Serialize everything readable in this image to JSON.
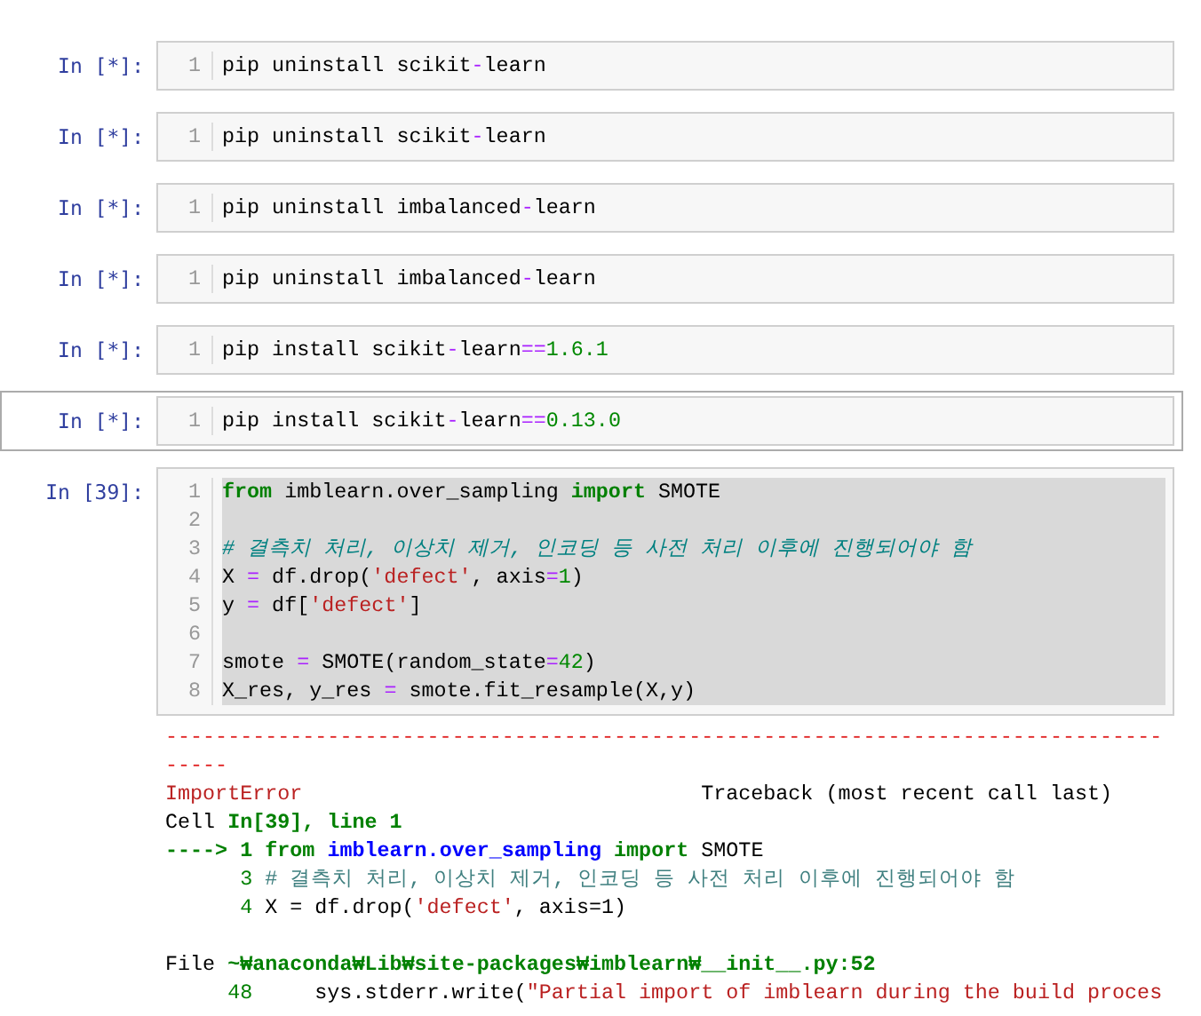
{
  "cells": [
    {
      "prompt": "In [*]:",
      "selected": false,
      "lines": [
        {
          "number": "1",
          "selected": false,
          "tokens": [
            {
              "kind": "plain",
              "text": "pip uninstall scikit"
            },
            {
              "kind": "op",
              "text": "-"
            },
            {
              "kind": "plain",
              "text": "learn"
            }
          ]
        }
      ]
    },
    {
      "prompt": "In [*]:",
      "selected": false,
      "lines": [
        {
          "number": "1",
          "selected": false,
          "tokens": [
            {
              "kind": "plain",
              "text": "pip uninstall scikit"
            },
            {
              "kind": "op",
              "text": "-"
            },
            {
              "kind": "plain",
              "text": "learn"
            }
          ]
        }
      ]
    },
    {
      "prompt": "In [*]:",
      "selected": false,
      "lines": [
        {
          "number": "1",
          "selected": false,
          "tokens": [
            {
              "kind": "plain",
              "text": "pip uninstall imbalanced"
            },
            {
              "kind": "op",
              "text": "-"
            },
            {
              "kind": "plain",
              "text": "learn"
            }
          ]
        }
      ]
    },
    {
      "prompt": "In [*]:",
      "selected": false,
      "lines": [
        {
          "number": "1",
          "selected": false,
          "tokens": [
            {
              "kind": "plain",
              "text": "pip uninstall imbalanced"
            },
            {
              "kind": "op",
              "text": "-"
            },
            {
              "kind": "plain",
              "text": "learn"
            }
          ]
        }
      ]
    },
    {
      "prompt": "In [*]:",
      "selected": false,
      "lines": [
        {
          "number": "1",
          "selected": false,
          "tokens": [
            {
              "kind": "plain",
              "text": "pip install scikit"
            },
            {
              "kind": "op",
              "text": "-"
            },
            {
              "kind": "plain",
              "text": "learn"
            },
            {
              "kind": "op",
              "text": "=="
            },
            {
              "kind": "num",
              "text": "1.6.1"
            }
          ]
        }
      ]
    },
    {
      "prompt": "In [*]:",
      "selected": true,
      "lines": [
        {
          "number": "1",
          "selected": false,
          "tokens": [
            {
              "kind": "plain",
              "text": "pip install scikit"
            },
            {
              "kind": "op",
              "text": "-"
            },
            {
              "kind": "plain",
              "text": "learn"
            },
            {
              "kind": "op",
              "text": "=="
            },
            {
              "kind": "num",
              "text": "0.13.0"
            }
          ]
        }
      ]
    },
    {
      "prompt": "In [39]:",
      "selected": false,
      "lines": [
        {
          "number": "1",
          "selected": true,
          "tokens": [
            {
              "kind": "kw",
              "text": "from"
            },
            {
              "kind": "plain",
              "text": " imblearn.over_sampling "
            },
            {
              "kind": "kw",
              "text": "import"
            },
            {
              "kind": "plain",
              "text": " SMOTE"
            }
          ]
        },
        {
          "number": "2",
          "selected": true
        },
        {
          "number": "3",
          "selected": true,
          "tokens": [
            {
              "kind": "comment",
              "text": "# 결측치 처리, 이상치 제거, 인코딩 등 사전 처리 이후에 진행되어야 함"
            }
          ]
        },
        {
          "number": "4",
          "selected": true,
          "tokens": [
            {
              "kind": "plain",
              "text": "X "
            },
            {
              "kind": "op",
              "text": "="
            },
            {
              "kind": "plain",
              "text": " df.drop("
            },
            {
              "kind": "str",
              "text": "'defect'"
            },
            {
              "kind": "plain",
              "text": ", axis"
            },
            {
              "kind": "op",
              "text": "="
            },
            {
              "kind": "num",
              "text": "1"
            },
            {
              "kind": "plain",
              "text": ")"
            }
          ]
        },
        {
          "number": "5",
          "selected": true,
          "tokens": [
            {
              "kind": "plain",
              "text": "y "
            },
            {
              "kind": "op",
              "text": "="
            },
            {
              "kind": "plain",
              "text": " df["
            },
            {
              "kind": "str",
              "text": "'defect'"
            },
            {
              "kind": "plain",
              "text": "]"
            }
          ]
        },
        {
          "number": "6",
          "selected": true
        },
        {
          "number": "7",
          "selected": true,
          "tokens": [
            {
              "kind": "plain",
              "text": "smote "
            },
            {
              "kind": "op",
              "text": "="
            },
            {
              "kind": "plain",
              "text": " SMOTE(random_state"
            },
            {
              "kind": "op",
              "text": "="
            },
            {
              "kind": "num",
              "text": "42"
            },
            {
              "kind": "plain",
              "text": ")"
            }
          ]
        },
        {
          "number": "8",
          "selected": true,
          "tokens": [
            {
              "kind": "plain",
              "text": "X_res, y_res "
            },
            {
              "kind": "op",
              "text": "="
            },
            {
              "kind": "plain",
              "text": " smote.fit_resample(X,y)"
            }
          ]
        }
      ],
      "output": {
        "rule": "-------------------------------------------------------------------------------------",
        "error": "ImportError",
        "note": "Traceback (most recent call last)",
        "lines": [
          {
            "tokens": [
              {
                "kind": "plain",
                "text": "Cell "
              },
              {
                "kind": "loc",
                "text": "In[39], line 1"
              }
            ]
          },
          {
            "tokens": [
              {
                "kind": "arrow",
                "text": "----> 1"
              },
              {
                "kind": "kw",
                "text": " from"
              },
              {
                "kind": "mod",
                "text": " imblearn.over_sampling"
              },
              {
                "kind": "kw",
                "text": " import"
              },
              {
                "kind": "plain",
                "text": " SMOTE"
              }
            ]
          },
          {
            "tokens": [
              {
                "kind": "lineno",
                "text": "3"
              },
              {
                "kind": "tbcomment",
                "text": "# 결측치 처리, 이상치 제거, 인코딩 등 사전 처리 이후에 진행되어야 함"
              }
            ]
          },
          {
            "tokens": [
              {
                "kind": "lineno",
                "text": "4"
              },
              {
                "kind": "plain",
                "text": "X = df.drop("
              },
              {
                "kind": "str",
                "text": "'defect'"
              },
              {
                "kind": "plain",
                "text": ", axis=1)"
              }
            ]
          }
        ],
        "source_lines": [
          {
            "tokens": [
              {
                "kind": "plain",
                "text": "File "
              },
              {
                "kind": "loc",
                "text": "~₩anaconda₩Lib₩site-packages₩imblearn₩__init__.py:52"
              }
            ]
          },
          {
            "tokens": [
              {
                "kind": "lineno",
                "text": "48"
              },
              {
                "kind": "plain",
                "text": "    sys.stderr.write("
              },
              {
                "kind": "str",
                "text": "\"Partial import of imblearn during the build proces"
              }
            ]
          }
        ]
      }
    }
  ]
}
